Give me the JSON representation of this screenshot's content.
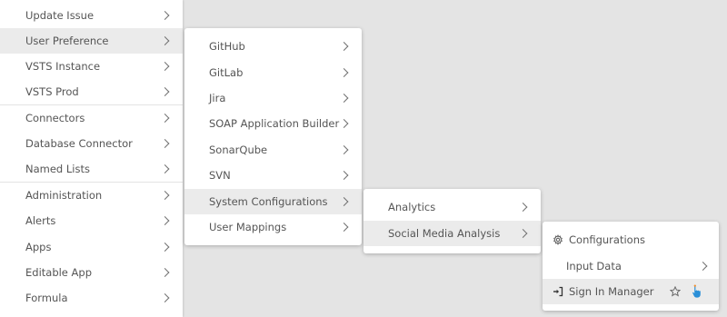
{
  "menu_level1": {
    "items": [
      {
        "label": "Update Issue"
      },
      {
        "label": "User Preference"
      },
      {
        "label": "VSTS Instance"
      },
      {
        "label": "VSTS Prod"
      },
      {
        "label": "Connectors"
      },
      {
        "label": "Database Connector"
      },
      {
        "label": "Named Lists"
      },
      {
        "label": "Administration"
      },
      {
        "label": "Alerts"
      },
      {
        "label": "Apps"
      },
      {
        "label": "Editable App"
      },
      {
        "label": "Formula"
      }
    ],
    "active_item": "User Preference"
  },
  "menu_level2": {
    "items": [
      {
        "label": "GitHub"
      },
      {
        "label": "GitLab"
      },
      {
        "label": "Jira"
      },
      {
        "label": "SOAP Application Builder"
      },
      {
        "label": "SonarQube"
      },
      {
        "label": "SVN"
      },
      {
        "label": "System Configurations"
      },
      {
        "label": "User Mappings"
      }
    ],
    "active_item": "System Configurations"
  },
  "menu_level3": {
    "items": [
      {
        "label": "Analytics"
      },
      {
        "label": "Social Media Analysis"
      }
    ],
    "active_item": "Social Media Analysis"
  },
  "menu_level4": {
    "items": [
      {
        "label": "Configurations",
        "icon": "gear-icon"
      },
      {
        "label": "Input Data"
      },
      {
        "label": "Sign In Manager",
        "icon": "sign-in-icon",
        "trailing_icons": [
          "star-icon",
          "pointing-hand-icon"
        ]
      }
    ],
    "active_item": "Sign In Manager"
  },
  "colors": {
    "background": "#e4e4e4",
    "menu_background": "#ffffff",
    "active_row": "#ebebeb",
    "text": "#555555",
    "hand_icon_accent": "#2a8fd8"
  }
}
